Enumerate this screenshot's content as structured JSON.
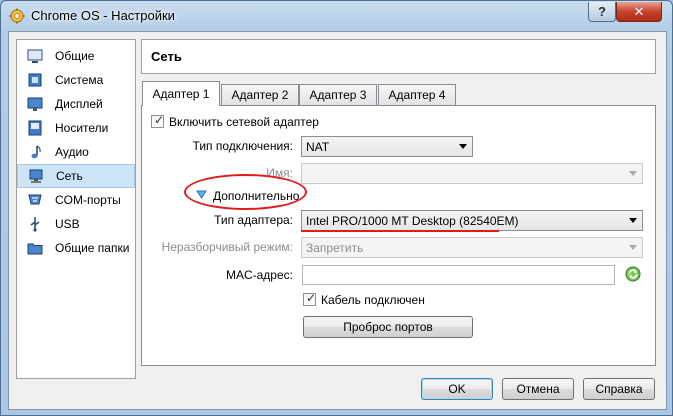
{
  "window": {
    "title": "Chrome OS - Настройки",
    "help_button": "?",
    "close_button": "✕"
  },
  "sidebar": {
    "items": [
      {
        "label": "Общие",
        "icon": "general-icon"
      },
      {
        "label": "Система",
        "icon": "system-icon"
      },
      {
        "label": "Дисплей",
        "icon": "display-icon"
      },
      {
        "label": "Носители",
        "icon": "storage-icon"
      },
      {
        "label": "Аудио",
        "icon": "audio-icon"
      },
      {
        "label": "Сеть",
        "icon": "network-icon",
        "selected": true
      },
      {
        "label": "COM-порты",
        "icon": "serial-ports-icon"
      },
      {
        "label": "USB",
        "icon": "usb-icon"
      },
      {
        "label": "Общие папки",
        "icon": "shared-folders-icon"
      }
    ]
  },
  "header": {
    "title": "Сеть"
  },
  "tabs": [
    "Адаптер 1",
    "Адаптер 2",
    "Адаптер 3",
    "Адаптер 4"
  ],
  "active_tab": 0,
  "adapter": {
    "enable_label": "Включить сетевой адаптер",
    "enable_checked": true,
    "attached_label": "Тип подключения:",
    "attached_value": "NAT",
    "name_label": "Имя:",
    "name_value": "",
    "advanced_label": "Дополнительно",
    "adapter_type_label": "Тип адаптера:",
    "adapter_type_value": "Intel PRO/1000 MT Desktop (82540EM)",
    "promisc_label": "Неразборчивый режим:",
    "promisc_value": "Запретить",
    "mac_label": "MAC-адрес:",
    "mac_value": "",
    "cable_label": "Кабель подключен",
    "cable_checked": true,
    "port_forward_button": "Проброс портов"
  },
  "footer": {
    "ok": "OK",
    "cancel": "Отмена",
    "help": "Справка"
  },
  "colors": {
    "annotation": "#e01b1b",
    "selection": "#cde4f7",
    "refresh_icon": "#3c9a2a"
  }
}
